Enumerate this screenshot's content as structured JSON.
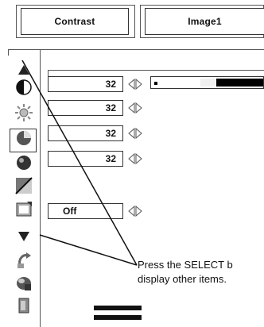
{
  "tabs": [
    {
      "label": "Contrast"
    },
    {
      "label": "Image1"
    }
  ],
  "sidebar": {
    "items": [
      {
        "icon": "triangle-up-icon"
      },
      {
        "icon": "contrast-icon"
      },
      {
        "icon": "brightness-icon"
      },
      {
        "icon": "color-icon"
      },
      {
        "icon": "tint-icon"
      },
      {
        "icon": "sharpness-icon"
      },
      {
        "icon": "auto-icon"
      },
      {
        "icon": "triangle-down-icon"
      },
      {
        "icon": "reset-icon"
      },
      {
        "icon": "store-icon"
      },
      {
        "icon": "exit-icon"
      }
    ]
  },
  "rows": [
    {
      "value": "32"
    },
    {
      "value": "32"
    },
    {
      "value": "32"
    },
    {
      "value": "32"
    },
    {
      "value": "Off"
    }
  ],
  "slider": {
    "level": 0.32
  },
  "callout": {
    "line1": "Press the SELECT b",
    "line2": "display other items."
  }
}
